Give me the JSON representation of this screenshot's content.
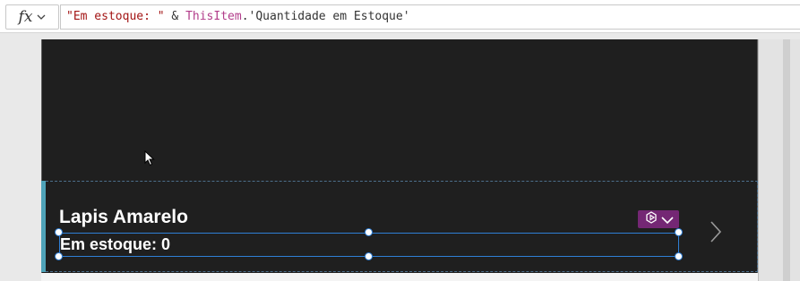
{
  "formula_bar": {
    "fx_label": "fx",
    "tokens": {
      "string_literal": "\"Em estoque: \"",
      "operator": " & ",
      "reference": "ThisItem",
      "property": ".'Quantidade em Estoque'"
    }
  },
  "gallery": {
    "item_title": "Lapis Amarelo",
    "stock_text": "Em estoque: 0",
    "badge_icon": "component-icon",
    "next_icon": "chevron-right-icon"
  },
  "colors": {
    "formula_string": "#a31515",
    "formula_reference": "#b23c8a",
    "selection_outline": "#2f7fd6",
    "selected_indicator": "#4fa3b8",
    "badge_background": "#742774",
    "screen_background": "#1f1f1f"
  }
}
